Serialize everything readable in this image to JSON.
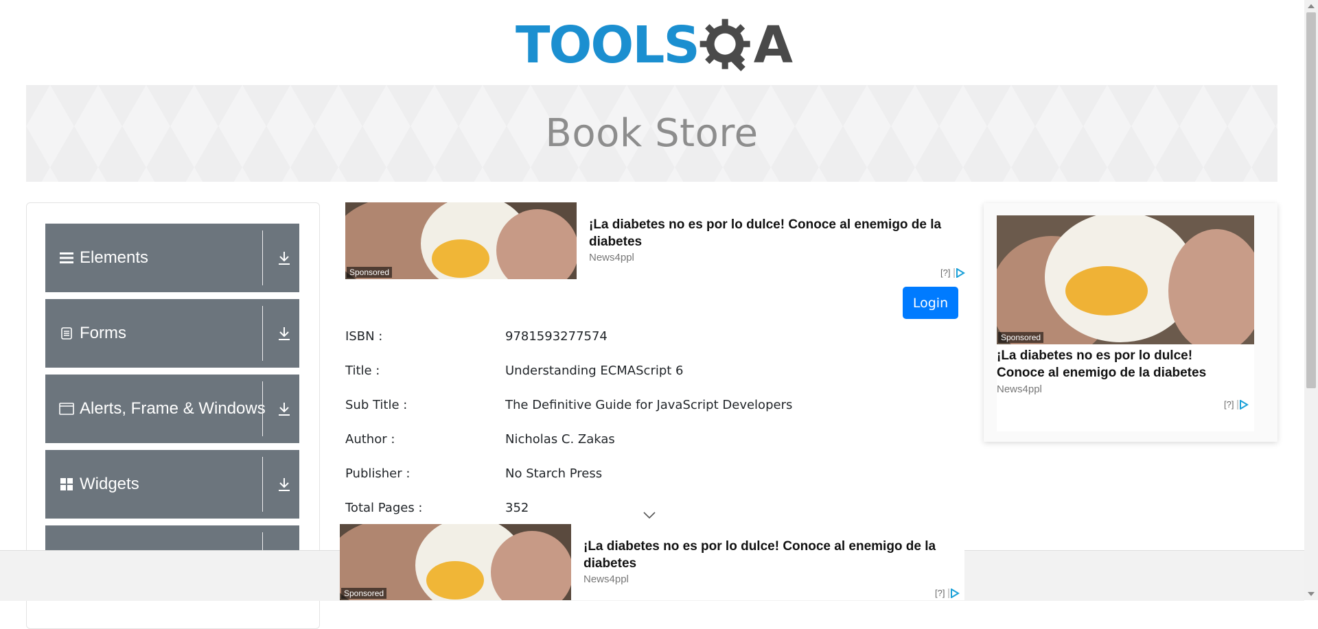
{
  "brand": {
    "tools": "TOOLS",
    "qa": "A",
    "name": "TOOLSQA"
  },
  "banner": {
    "title": "Book Store"
  },
  "sidebar": {
    "groups": [
      {
        "label": "Elements",
        "icon": "hamburger-icon"
      },
      {
        "label": "Forms",
        "icon": "document-icon"
      },
      {
        "label": "Alerts, Frame & Windows",
        "icon": "window-icon"
      },
      {
        "label": "Widgets",
        "icon": "grid-icon"
      },
      {
        "label": "",
        "icon": ""
      }
    ]
  },
  "ads": {
    "top_inline": {
      "title": "¡La diabetes no es por lo dulce! Conoce al enemigo de la diabetes",
      "source": "News4ppl",
      "sponsored": "Sponsored",
      "info": "[?]"
    },
    "side": {
      "title": "¡La diabetes no es por lo dulce! Conoce al enemigo de la diabetes",
      "source": "News4ppl",
      "sponsored": "Sponsored",
      "info": "[?]"
    },
    "bottom": {
      "title": "¡La diabetes no es por lo dulce! Conoce al enemigo de la diabetes",
      "source": "News4ppl",
      "sponsored": "Sponsored",
      "info": "[?]"
    }
  },
  "login": {
    "label": "Login"
  },
  "book": [
    {
      "label": "ISBN :",
      "value": "9781593277574"
    },
    {
      "label": "Title :",
      "value": "Understanding ECMAScript 6"
    },
    {
      "label": "Sub Title :",
      "value": "The Definitive Guide for JavaScript Developers"
    },
    {
      "label": "Author :",
      "value": "Nicholas C. Zakas"
    },
    {
      "label": "Publisher :",
      "value": "No Starch Press"
    },
    {
      "label": "Total Pages :",
      "value": "352"
    }
  ],
  "colors": {
    "brand_blue": "#1b8fd0",
    "brand_dark": "#4a4a4a",
    "sidebar_group": "#6c757d",
    "primary_button": "#007bff",
    "banner_text": "#8d8d8d"
  }
}
